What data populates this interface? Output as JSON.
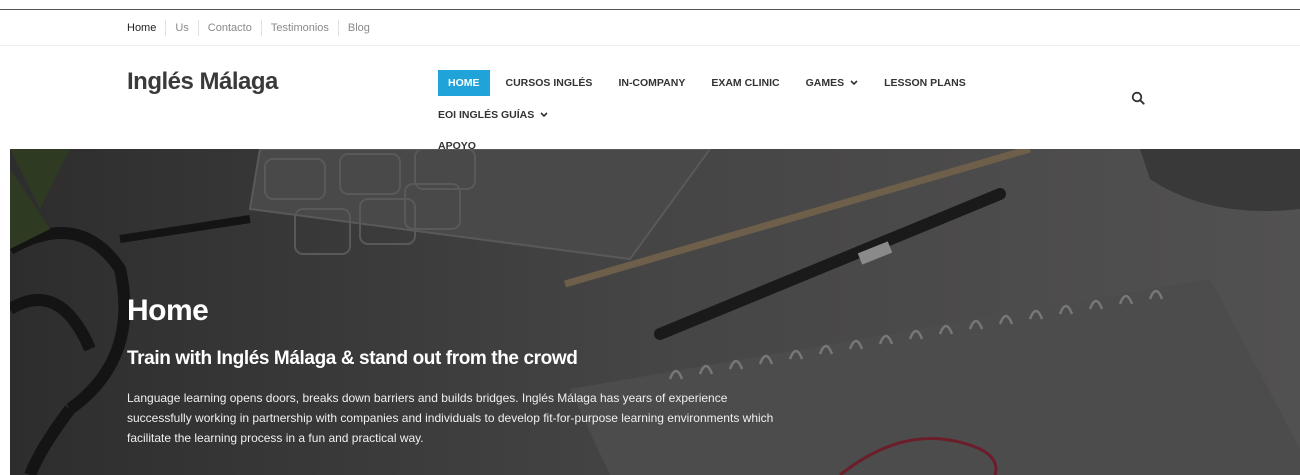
{
  "topbar": {
    "links": [
      "Home",
      "Us",
      "Contacto",
      "Testimonios",
      "Blog"
    ]
  },
  "header": {
    "brand": "Inglés Málaga"
  },
  "nav": {
    "items": [
      {
        "label": "HOME",
        "active": true,
        "dropdown": false
      },
      {
        "label": "CURSOS INGLÉS",
        "active": false,
        "dropdown": false
      },
      {
        "label": "IN-COMPANY",
        "active": false,
        "dropdown": false
      },
      {
        "label": "EXAM CLINIC",
        "active": false,
        "dropdown": false
      },
      {
        "label": "GAMES",
        "active": false,
        "dropdown": true
      },
      {
        "label": "LESSON PLANS",
        "active": false,
        "dropdown": false
      },
      {
        "label": "EOI INGLÉS GUÍAS",
        "active": false,
        "dropdown": true
      },
      {
        "label": "APOYO",
        "active": false,
        "dropdown": false
      }
    ],
    "search_icon": "search-icon"
  },
  "hero": {
    "title": "Home",
    "subtitle": "Train with Inglés Málaga & stand out from the crowd",
    "text": "Language learning opens doors, breaks down barriers and builds bridges. Inglés Málaga has years of experience successfully working in partnership with companies and individuals to develop fit-for-purpose learning environments which facilitate the learning process in a fun and practical way."
  },
  "colors": {
    "accent": "#1fa3d9",
    "hero_overlay": "#3e3d3d",
    "text_dark": "#333333"
  }
}
